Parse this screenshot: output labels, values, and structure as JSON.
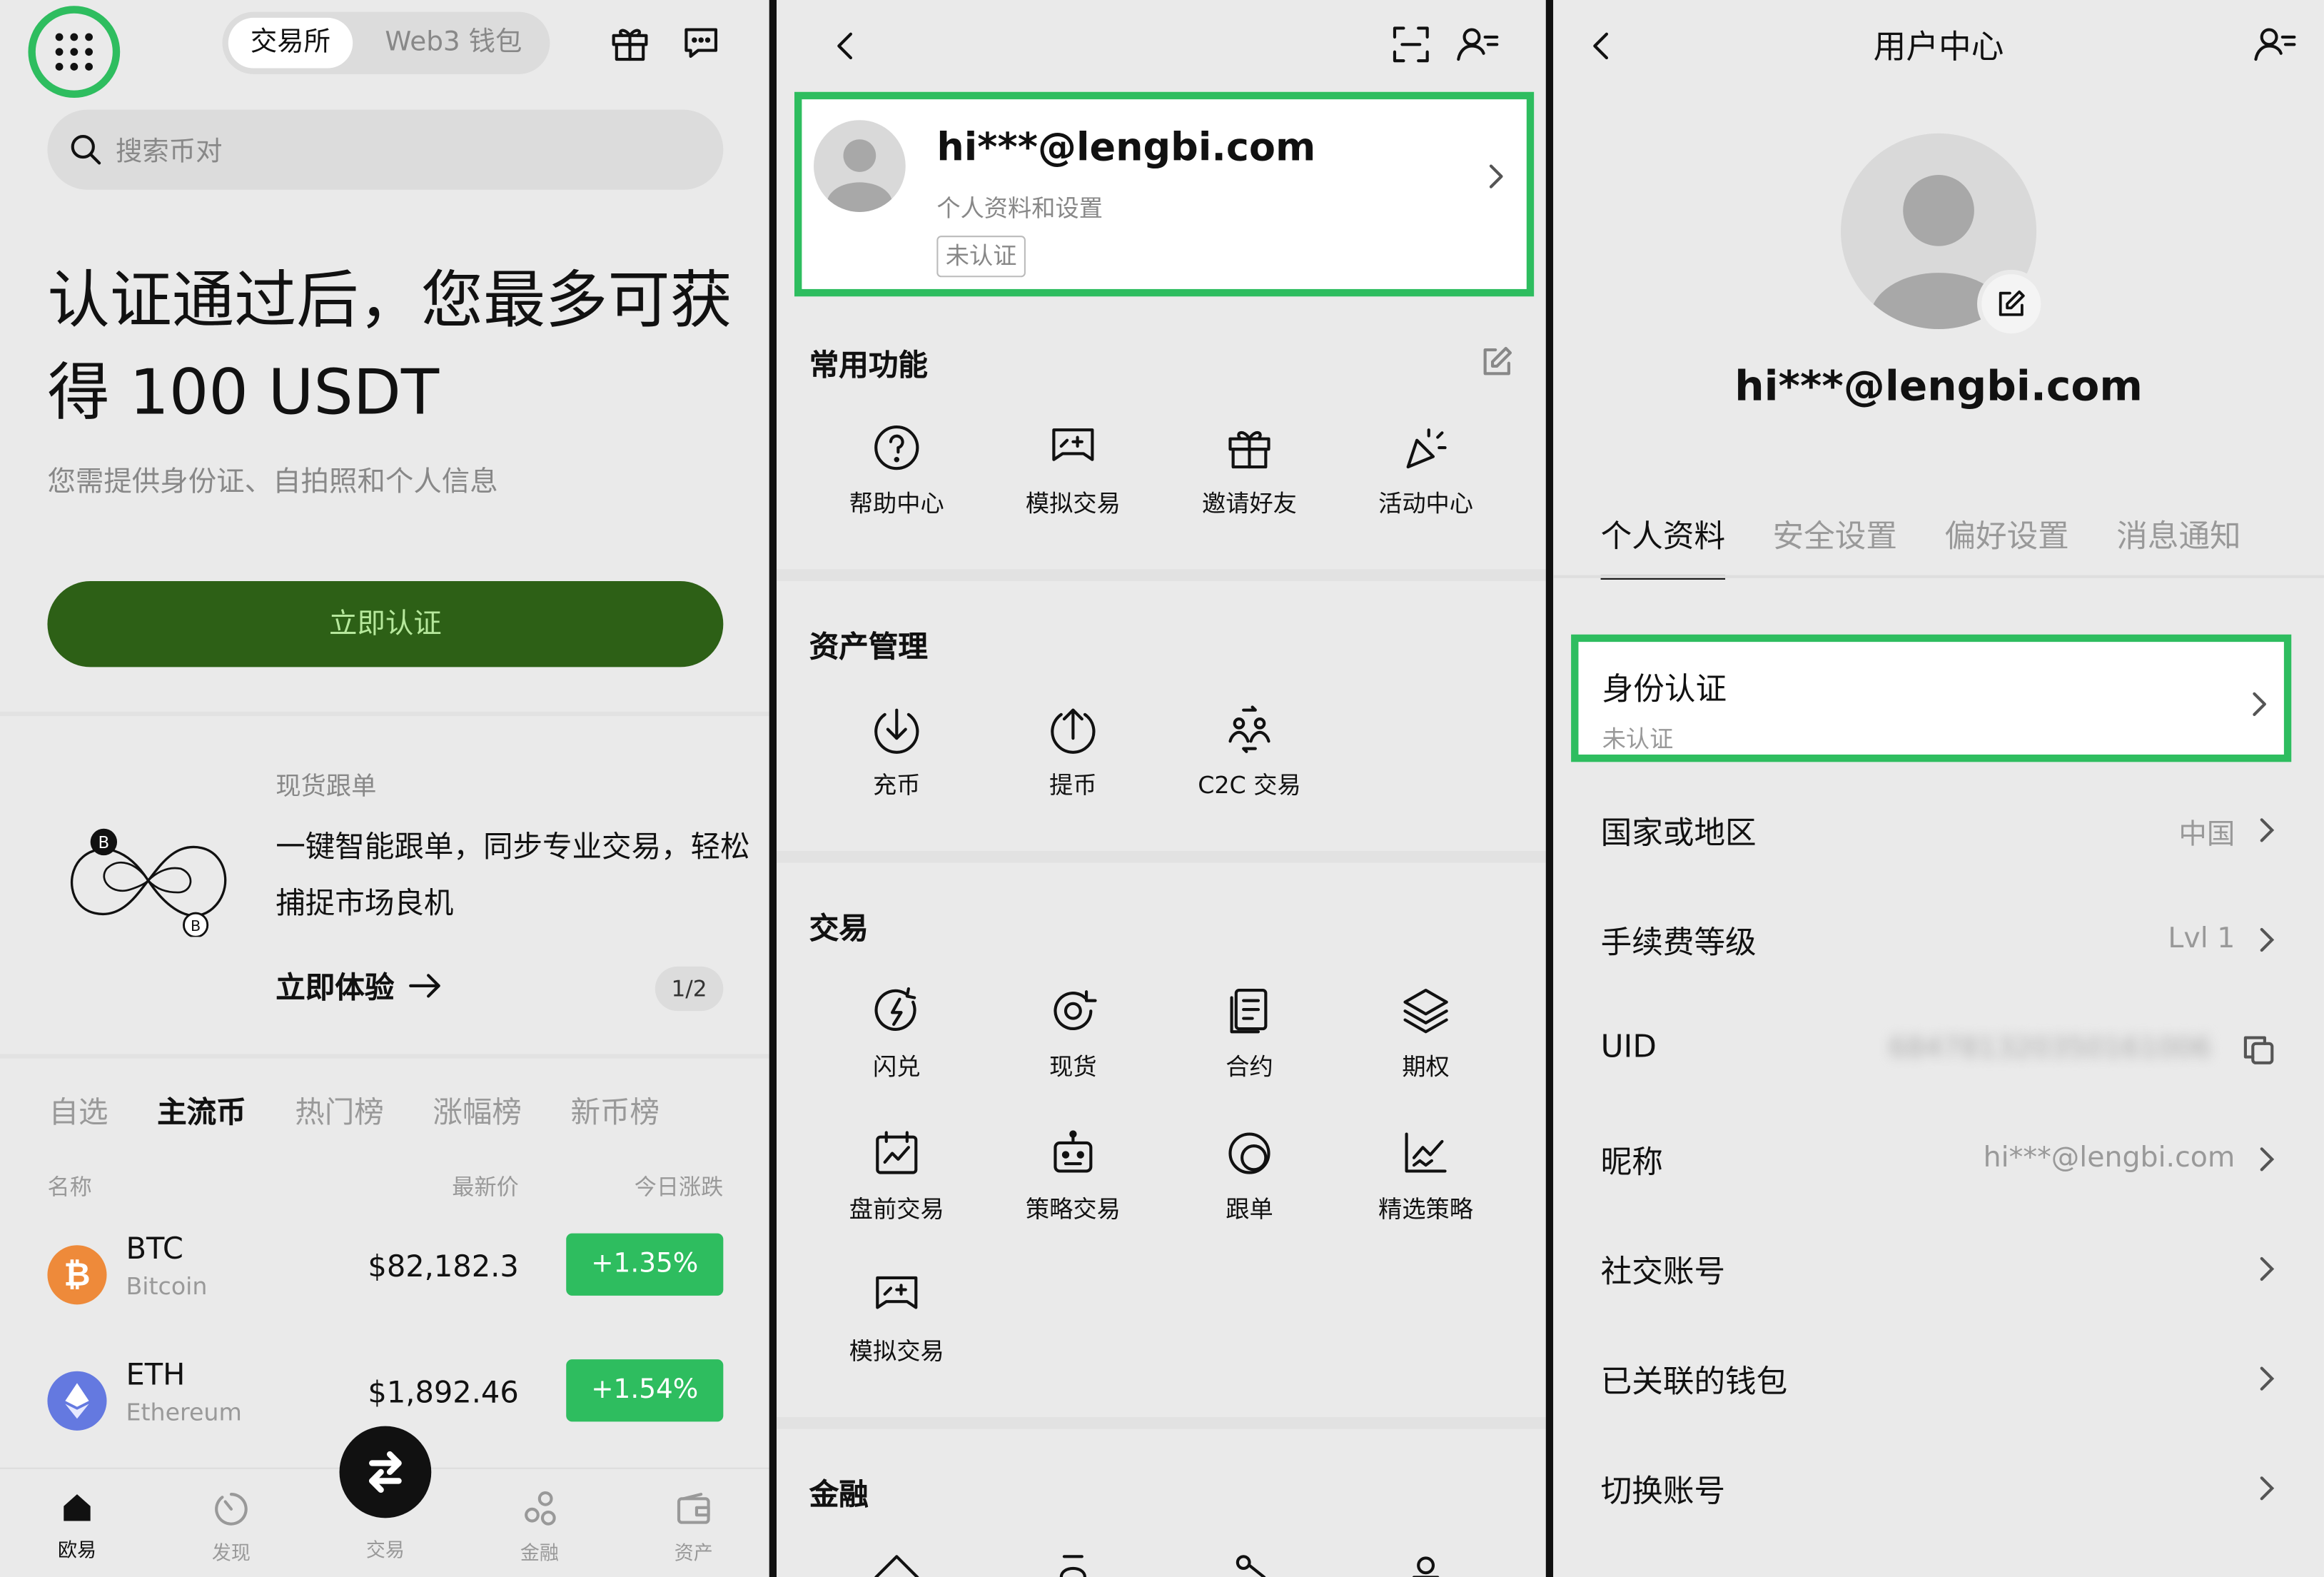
{
  "colors": {
    "accent_green": "#2ebd5f",
    "cta_green": "#2d6016",
    "cta_text": "#b6e89c",
    "btc": "#ee8a3a",
    "eth": "#6479e0"
  },
  "panel1": {
    "segment": {
      "exchange": "交易所",
      "web3": "Web3 钱包"
    },
    "search_placeholder": "搜索币对",
    "kyc_title": "认证通过后，您最多可获得 100 USDT",
    "kyc_subtitle": "您需提供身份证、自拍照和个人信息",
    "verify_button": "立即认证",
    "copy_trade": {
      "label": "现货跟单",
      "desc": "一键智能跟单，同步专业交易，轻松捕捉市场良机",
      "cta": "立即体验",
      "page": "1/2"
    },
    "market_tabs": [
      "自选",
      "主流币",
      "热门榜",
      "涨幅榜",
      "新币榜"
    ],
    "active_tab": "主流币",
    "table_header": {
      "name": "名称",
      "price": "最新价",
      "change": "今日涨跌"
    },
    "coins": [
      {
        "symbol": "BTC",
        "name": "Bitcoin",
        "price": "$82,182.3",
        "change": "+1.35%",
        "icon": "bitcoin-icon"
      },
      {
        "symbol": "ETH",
        "name": "Ethereum",
        "price": "$1,892.46",
        "change": "+1.54%",
        "icon": "ethereum-icon"
      }
    ],
    "bottom_nav": {
      "okx": "欧易",
      "discover": "发现",
      "trade": "交易",
      "finance": "金融",
      "assets": "资产"
    }
  },
  "panel2": {
    "email": "hi***@lengbi.com",
    "profile_sub": "个人资料和设置",
    "unverified": "未认证",
    "sections": {
      "common": {
        "title": "常用功能",
        "items": [
          "帮助中心",
          "模拟交易",
          "邀请好友",
          "活动中心"
        ]
      },
      "assets": {
        "title": "资产管理",
        "items": [
          "充币",
          "提币",
          "C2C 交易"
        ]
      },
      "trade": {
        "title": "交易",
        "items": [
          "闪兑",
          "现货",
          "合约",
          "期权",
          "盘前交易",
          "策略交易",
          "跟单",
          "精选策略",
          "模拟交易"
        ]
      },
      "finance": {
        "title": "金融"
      }
    }
  },
  "panel3": {
    "title": "用户中心",
    "email": "hi***@lengbi.com",
    "tabs": [
      "个人资料",
      "安全设置",
      "偏好设置",
      "消息通知"
    ],
    "identity": {
      "title": "身份认证",
      "status": "未认证"
    },
    "rows": [
      {
        "label": "国家或地区",
        "value": "中国"
      },
      {
        "label": "手续费等级",
        "value": "Lvl 1"
      },
      {
        "label": "UID",
        "value": "684781320350161006"
      },
      {
        "label": "昵称",
        "value": "hi***@lengbi.com"
      },
      {
        "label": "社交账号",
        "value": ""
      },
      {
        "label": "已关联的钱包",
        "value": ""
      },
      {
        "label": "切换账号",
        "value": ""
      }
    ]
  }
}
